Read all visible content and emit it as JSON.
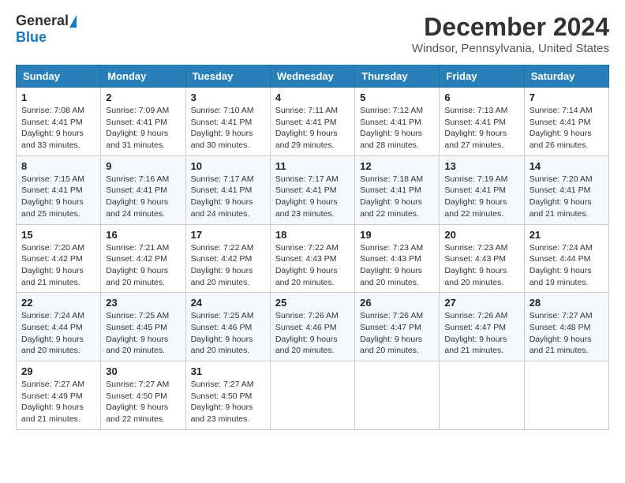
{
  "header": {
    "logo_general": "General",
    "logo_blue": "Blue",
    "month_title": "December 2024",
    "location": "Windsor, Pennsylvania, United States"
  },
  "calendar": {
    "days_of_week": [
      "Sunday",
      "Monday",
      "Tuesday",
      "Wednesday",
      "Thursday",
      "Friday",
      "Saturday"
    ],
    "weeks": [
      [
        {
          "day": "1",
          "sunrise": "7:08 AM",
          "sunset": "4:41 PM",
          "daylight": "9 hours and 33 minutes."
        },
        {
          "day": "2",
          "sunrise": "7:09 AM",
          "sunset": "4:41 PM",
          "daylight": "9 hours and 31 minutes."
        },
        {
          "day": "3",
          "sunrise": "7:10 AM",
          "sunset": "4:41 PM",
          "daylight": "9 hours and 30 minutes."
        },
        {
          "day": "4",
          "sunrise": "7:11 AM",
          "sunset": "4:41 PM",
          "daylight": "9 hours and 29 minutes."
        },
        {
          "day": "5",
          "sunrise": "7:12 AM",
          "sunset": "4:41 PM",
          "daylight": "9 hours and 28 minutes."
        },
        {
          "day": "6",
          "sunrise": "7:13 AM",
          "sunset": "4:41 PM",
          "daylight": "9 hours and 27 minutes."
        },
        {
          "day": "7",
          "sunrise": "7:14 AM",
          "sunset": "4:41 PM",
          "daylight": "9 hours and 26 minutes."
        }
      ],
      [
        {
          "day": "8",
          "sunrise": "7:15 AM",
          "sunset": "4:41 PM",
          "daylight": "9 hours and 25 minutes."
        },
        {
          "day": "9",
          "sunrise": "7:16 AM",
          "sunset": "4:41 PM",
          "daylight": "9 hours and 24 minutes."
        },
        {
          "day": "10",
          "sunrise": "7:17 AM",
          "sunset": "4:41 PM",
          "daylight": "9 hours and 24 minutes."
        },
        {
          "day": "11",
          "sunrise": "7:17 AM",
          "sunset": "4:41 PM",
          "daylight": "9 hours and 23 minutes."
        },
        {
          "day": "12",
          "sunrise": "7:18 AM",
          "sunset": "4:41 PM",
          "daylight": "9 hours and 22 minutes."
        },
        {
          "day": "13",
          "sunrise": "7:19 AM",
          "sunset": "4:41 PM",
          "daylight": "9 hours and 22 minutes."
        },
        {
          "day": "14",
          "sunrise": "7:20 AM",
          "sunset": "4:41 PM",
          "daylight": "9 hours and 21 minutes."
        }
      ],
      [
        {
          "day": "15",
          "sunrise": "7:20 AM",
          "sunset": "4:42 PM",
          "daylight": "9 hours and 21 minutes."
        },
        {
          "day": "16",
          "sunrise": "7:21 AM",
          "sunset": "4:42 PM",
          "daylight": "9 hours and 20 minutes."
        },
        {
          "day": "17",
          "sunrise": "7:22 AM",
          "sunset": "4:42 PM",
          "daylight": "9 hours and 20 minutes."
        },
        {
          "day": "18",
          "sunrise": "7:22 AM",
          "sunset": "4:43 PM",
          "daylight": "9 hours and 20 minutes."
        },
        {
          "day": "19",
          "sunrise": "7:23 AM",
          "sunset": "4:43 PM",
          "daylight": "9 hours and 20 minutes."
        },
        {
          "day": "20",
          "sunrise": "7:23 AM",
          "sunset": "4:43 PM",
          "daylight": "9 hours and 20 minutes."
        },
        {
          "day": "21",
          "sunrise": "7:24 AM",
          "sunset": "4:44 PM",
          "daylight": "9 hours and 19 minutes."
        }
      ],
      [
        {
          "day": "22",
          "sunrise": "7:24 AM",
          "sunset": "4:44 PM",
          "daylight": "9 hours and 20 minutes."
        },
        {
          "day": "23",
          "sunrise": "7:25 AM",
          "sunset": "4:45 PM",
          "daylight": "9 hours and 20 minutes."
        },
        {
          "day": "24",
          "sunrise": "7:25 AM",
          "sunset": "4:46 PM",
          "daylight": "9 hours and 20 minutes."
        },
        {
          "day": "25",
          "sunrise": "7:26 AM",
          "sunset": "4:46 PM",
          "daylight": "9 hours and 20 minutes."
        },
        {
          "day": "26",
          "sunrise": "7:26 AM",
          "sunset": "4:47 PM",
          "daylight": "9 hours and 20 minutes."
        },
        {
          "day": "27",
          "sunrise": "7:26 AM",
          "sunset": "4:47 PM",
          "daylight": "9 hours and 21 minutes."
        },
        {
          "day": "28",
          "sunrise": "7:27 AM",
          "sunset": "4:48 PM",
          "daylight": "9 hours and 21 minutes."
        }
      ],
      [
        {
          "day": "29",
          "sunrise": "7:27 AM",
          "sunset": "4:49 PM",
          "daylight": "9 hours and 21 minutes."
        },
        {
          "day": "30",
          "sunrise": "7:27 AM",
          "sunset": "4:50 PM",
          "daylight": "9 hours and 22 minutes."
        },
        {
          "day": "31",
          "sunrise": "7:27 AM",
          "sunset": "4:50 PM",
          "daylight": "9 hours and 23 minutes."
        },
        null,
        null,
        null,
        null
      ]
    ]
  }
}
